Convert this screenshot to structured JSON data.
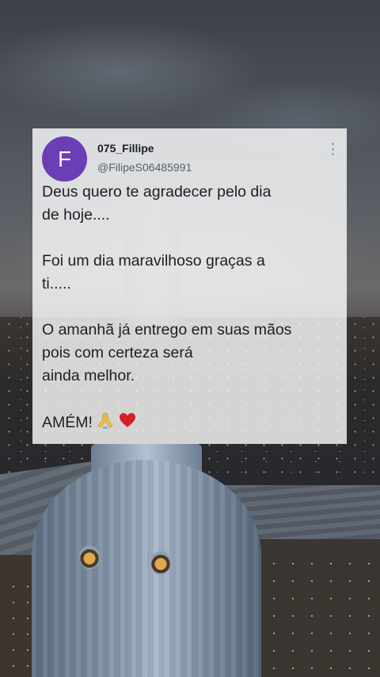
{
  "tweet": {
    "avatar_letter": "F",
    "display_name": "075_Fillipe",
    "handle": "@FilipeS06485991",
    "paragraphs": [
      [
        "Deus quero te agradecer pelo dia",
        "de hoje...."
      ],
      [
        "Foi um dia maravilhoso graças a",
        "ti....."
      ],
      [
        "O amanhã já entrego em suas mãos",
        "pois com certeza será",
        "ainda melhor."
      ]
    ],
    "closing": "AMÉM!",
    "closing_emojis": [
      "praying-hands-icon",
      "red-heart-icon"
    ]
  },
  "colors": {
    "avatar_bg": "#6a3fb5",
    "heart": "#d3202b",
    "hands": "#f4c542"
  }
}
